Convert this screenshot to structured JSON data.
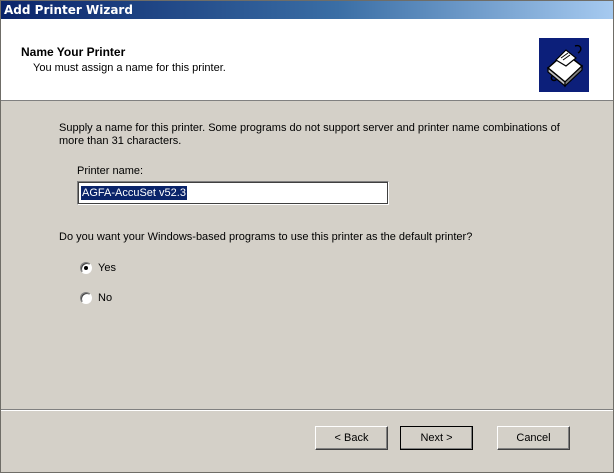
{
  "window": {
    "title": "Add Printer Wizard"
  },
  "header": {
    "title": "Name Your Printer",
    "subtitle": "You must assign a name for this printer.",
    "icon": "printer-icon"
  },
  "content": {
    "instructions": "Supply a name for this printer. Some programs do not support server and printer name combinations of more than 31 characters.",
    "printer_name_label": "Printer name:",
    "printer_name_value": "AGFA-AccuSet v52.3",
    "default_question": "Do you want your Windows-based programs to use this printer as the default printer?",
    "options": [
      {
        "label": "Yes",
        "selected": true
      },
      {
        "label": "No",
        "selected": false
      }
    ]
  },
  "buttons": {
    "back": "< Back",
    "next": "Next >",
    "cancel": "Cancel"
  },
  "colors": {
    "title_start": "#0a246a",
    "title_end": "#a6caf0",
    "dialog_bg": "#d4d0c8",
    "selection": "#0a246a"
  }
}
